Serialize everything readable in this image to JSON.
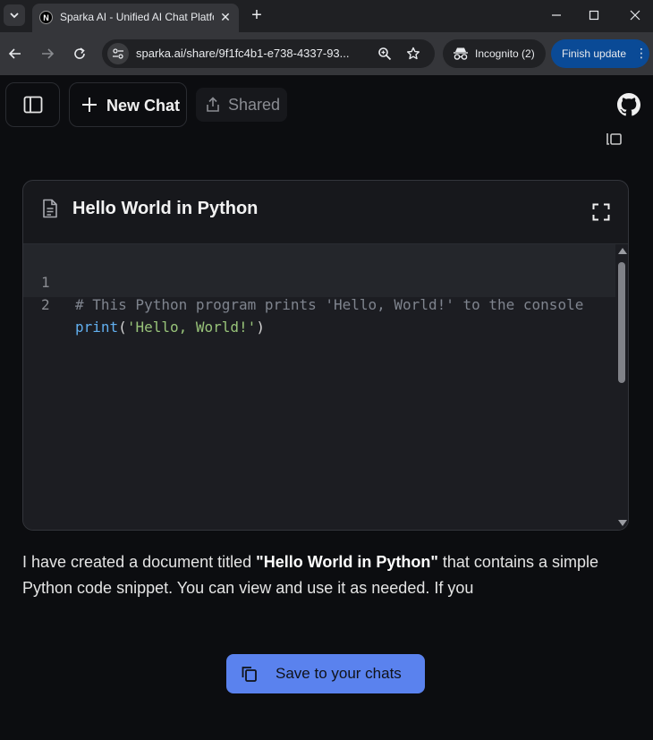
{
  "browser": {
    "tab_title": "Sparka AI - Unified AI Chat Platform",
    "favicon_letter": "N",
    "url": "sparka.ai/share/9f1fc4b1-e738-4337-93...",
    "incognito_label": "Incognito (2)",
    "update_label": "Finish update"
  },
  "header": {
    "new_chat_label": "New Chat",
    "shared_label": "Shared"
  },
  "document": {
    "title": "Hello World in Python",
    "lines": [
      {
        "number": "1",
        "text": "# This Python program prints 'Hello, World!' to the console"
      },
      {
        "number": "2",
        "func": "print",
        "open": "(",
        "string": "'Hello, World!'",
        "close": ")"
      }
    ]
  },
  "message": {
    "before": "I have created a document titled ",
    "title_bold": "\"Hello World in Python\"",
    "after": " that contains a simple Python code snippet. You can view and use it as needed. If you"
  },
  "save_button_label": "Save to your chats",
  "colors": {
    "accent_button": "#5a82ee",
    "update_button": "#0a4a96",
    "background": "#0c0d10",
    "code_comment": "#7f848e",
    "code_function": "#61afef",
    "code_string": "#98c379"
  }
}
